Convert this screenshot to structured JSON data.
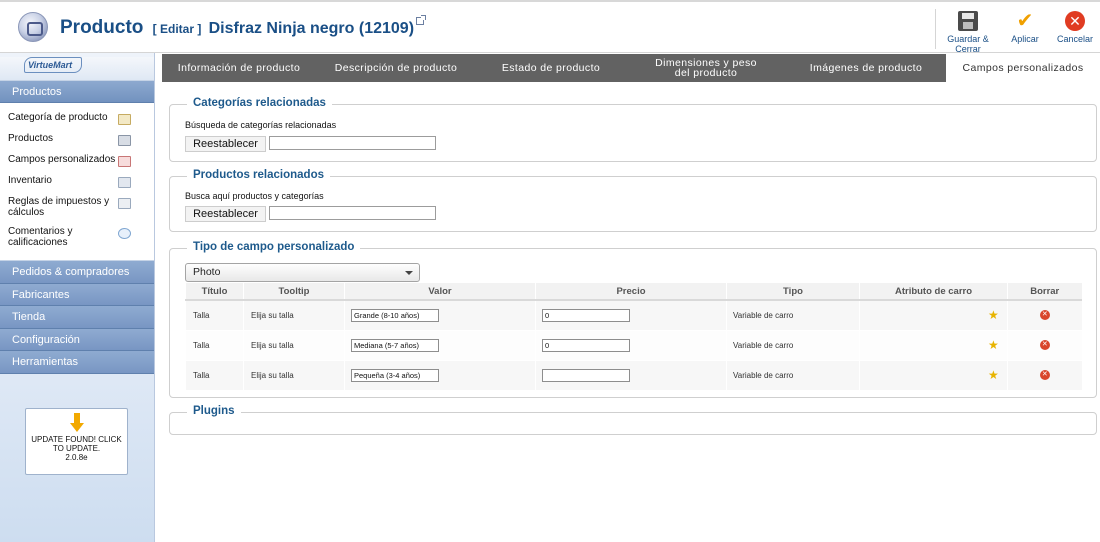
{
  "header": {
    "title": "Producto",
    "edit_label": "[ Editar ]",
    "product_name": "Disfraz Ninja negro (12109)",
    "toolbar": {
      "save_close": "Guardar & Cerrar",
      "apply": "Aplicar",
      "cancel": "Cancelar"
    }
  },
  "sidebar": {
    "logo_text": "VirtueMart",
    "section_title": "Productos",
    "items": [
      {
        "label": "Categoría de producto",
        "icon": "category-icon"
      },
      {
        "label": "Productos",
        "icon": "products-icon"
      },
      {
        "label": "Campos personalizados",
        "icon": "custom-fields-icon"
      },
      {
        "label": "Inventario",
        "icon": "inventory-icon"
      },
      {
        "label": "Reglas de impuestos y cálculos",
        "icon": "calculator-icon"
      },
      {
        "label": "Comentarios y calificaciones",
        "icon": "comments-icon"
      }
    ],
    "menu": [
      "Pedidos & compradores",
      "Fabricantes",
      "Tienda",
      "Configuración",
      "Herramientas"
    ],
    "update": {
      "line1": "UPDATE FOUND! CLICK TO UPDATE.",
      "version": "2.0.8e"
    }
  },
  "tabs": [
    {
      "label": "Información de producto",
      "active": false
    },
    {
      "label": "Descripción de producto",
      "active": false
    },
    {
      "label": "Estado de producto",
      "active": false
    },
    {
      "label": "Dimensiones y peso del producto",
      "active": false
    },
    {
      "label": "Imágenes de producto",
      "active": false
    },
    {
      "label": "Campos personalizados",
      "active": true
    }
  ],
  "sections": {
    "categorias": {
      "title": "Categorías relacionadas",
      "label": "Búsqueda de categorías relacionadas",
      "button": "Reestablecer"
    },
    "productos": {
      "title": "Productos relacionados",
      "label": "Busca aquí productos y categorías",
      "button": "Reestablecer"
    },
    "tipo": {
      "title": "Tipo de campo personalizado",
      "select_value": "Photo",
      "columns": [
        "Título",
        "Tooltip",
        "Valor",
        "Precio",
        "Tipo",
        "Atributo de carro",
        "Borrar"
      ],
      "rows": [
        {
          "titulo": "Talla",
          "tooltip": "Elija su talla",
          "valor": "Grande (8-10 años)",
          "precio": "0",
          "tipo": "Variable de carro"
        },
        {
          "titulo": "Talla",
          "tooltip": "Elija su talla",
          "valor": "Mediana (5-7 años)",
          "precio": "0",
          "tipo": "Variable de carro"
        },
        {
          "titulo": "Talla",
          "tooltip": "Elija su talla",
          "valor": "Pequeña (3-4 años)",
          "precio": "",
          "tipo": "Variable de carro"
        }
      ]
    },
    "plugins": {
      "title": "Plugins"
    }
  }
}
